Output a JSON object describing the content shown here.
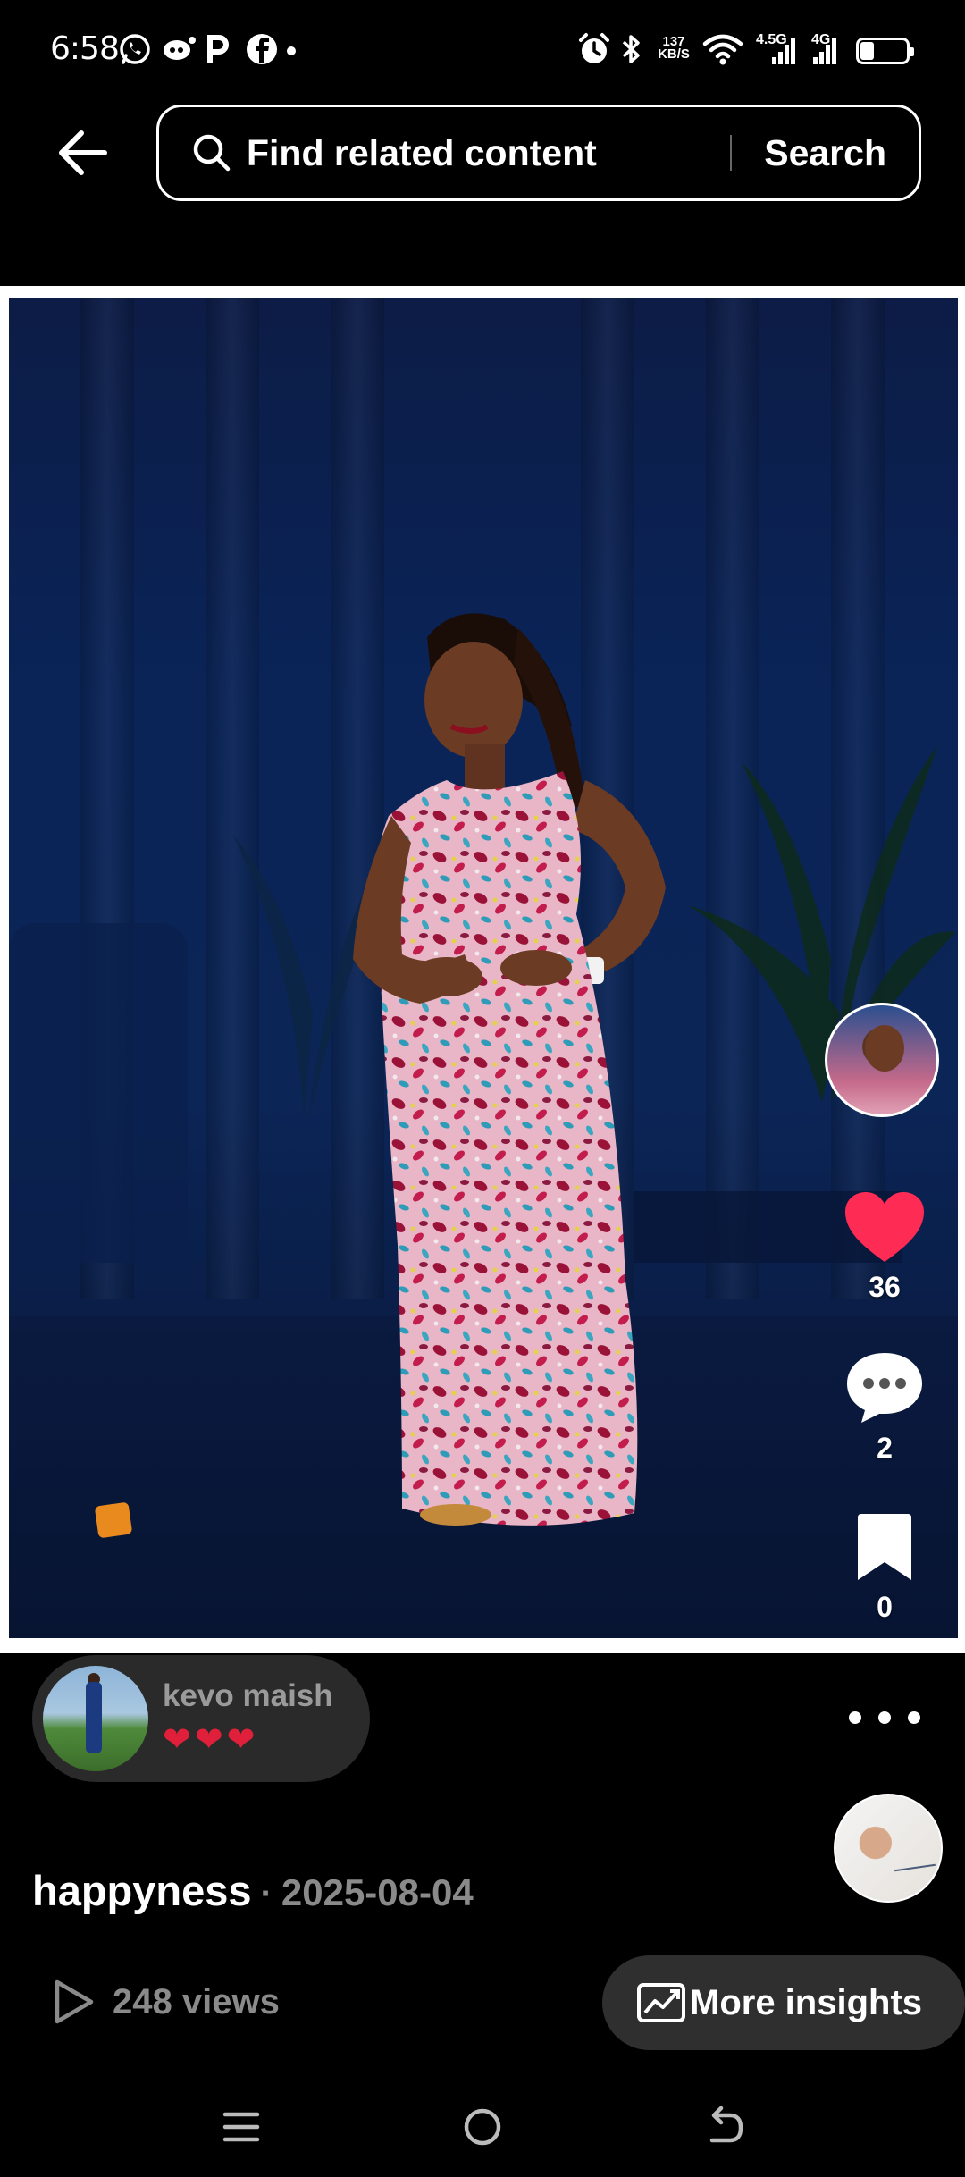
{
  "status_bar": {
    "time": "6:58",
    "net_speed_top": "137",
    "net_speed_bottom": "KB/S",
    "net1": "4.5G",
    "net2": "4G",
    "battery": "30",
    "battery_level": 0.3,
    "icons": [
      "whatsapp-icon",
      "notification-icon",
      "p-icon",
      "facebook-icon",
      "dot-icon",
      "alarm-icon",
      "bluetooth-icon",
      "wifi-icon",
      "signal-icon",
      "signal-icon",
      "battery-icon"
    ]
  },
  "header": {
    "back_icon": "arrow-left-icon",
    "search_placeholder": "Find related content",
    "search_button": "Search"
  },
  "media": {
    "sticker_icon": "spice-sticker"
  },
  "actions": {
    "likes": "36",
    "comments": "2",
    "saves": "0",
    "like_color": "#fe2c55"
  },
  "reaction": {
    "user": "kevo maish",
    "hearts": "❤❤❤"
  },
  "post": {
    "title": "happyness",
    "separator": "·",
    "date": "2025-08-04",
    "views": "248 views",
    "insights_label": "More insights"
  },
  "nav": {
    "icons": [
      "menu-icon",
      "home-icon",
      "back-icon"
    ]
  }
}
